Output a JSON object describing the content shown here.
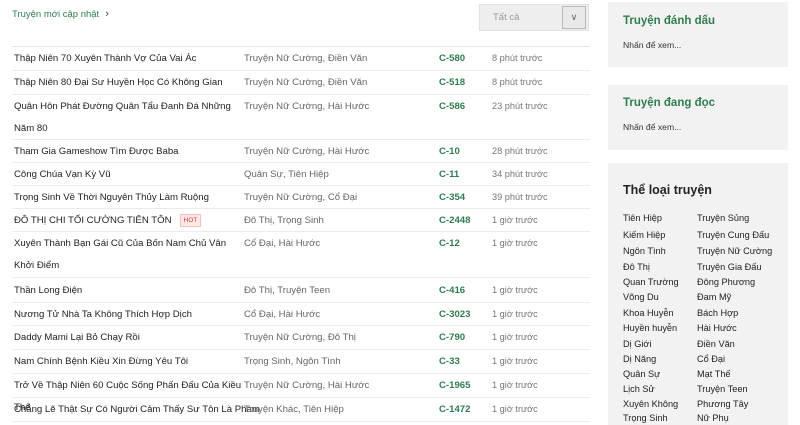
{
  "header": {
    "section_link": "Truyện mới cập nhật",
    "filter_value": "Tất cả"
  },
  "stories": [
    {
      "title": "Thập Niên 70 Xuyên Thành Vợ Của Vai Ác",
      "categories": "Truyện Nữ Cường, Điền Văn",
      "chapter": "C-580",
      "time": "8 phút trước"
    },
    {
      "title": "Thập Niên 80 Đại Sư Huyền Học Có Không Gian",
      "categories": "Truyện Nữ Cường, Điền Văn",
      "chapter": "C-518",
      "time": "8 phút trước"
    },
    {
      "title": "Quân Hôn Phát Đường Quân Tẩu Đanh Đá Những Năm 80",
      "categories": "Truyện Nữ Cường, Hài Hước",
      "chapter": "C-586",
      "time": "23 phút trước"
    },
    {
      "title": "Tham Gia Gameshow Tìm Được Baba",
      "categories": "Truyện Nữ Cường, Hài Hước",
      "chapter": "C-10",
      "time": "28 phút trước"
    },
    {
      "title": "Công Chúa Vạn Kỳ Vũ",
      "categories": "Quân Sự, Tiên Hiệp",
      "chapter": "C-11",
      "time": "34 phút trước"
    },
    {
      "title": "Trọng Sinh Về Thời Nguyên Thủy Làm Ruộng",
      "categories": "Truyện Nữ Cường, Cổ Đại",
      "chapter": "C-354",
      "time": "39 phút trước"
    },
    {
      "title": "ĐÔ THỊ CHI TỐI CƯỜNG TIÊN TÔN",
      "hot": "HOT",
      "categories": "Đô Thị, Trọng Sinh",
      "chapter": "C-2448",
      "time": "1 giờ trước"
    },
    {
      "title": "Xuyên Thành Bạn Gái Cũ Của Bốn Nam Chủ Vân Khởi Điểm",
      "categories": "Cổ Đại, Hài Hước",
      "chapter": "C-12",
      "time": "1 giờ trước"
    },
    {
      "title": "Thần Long Điện",
      "categories": "Đô Thị, Truyện Teen",
      "chapter": "C-416",
      "time": "1 giờ trước"
    },
    {
      "title": "Nương Tử Nhà Ta Không Thích Hợp Dịch",
      "categories": "Cổ Đại, Hài Hước",
      "chapter": "C-3023",
      "time": "1 giờ trước"
    },
    {
      "title": "Daddy Mami Lại Bỏ Chạy Rồi",
      "categories": "Truyện Nữ Cường, Đô Thị",
      "chapter": "C-790",
      "time": "1 giờ trước"
    },
    {
      "title": "Nam Chính Bệnh Kiều Xin Đừng Yêu Tôi",
      "categories": "Trọng Sinh, Ngôn Tình",
      "chapter": "C-33",
      "time": "1 giờ trước"
    },
    {
      "title": "Trở Về Thập Niên 60 Cuộc Sống Phấn Đấu Của Kiều Thê",
      "categories": "Truyện Nữ Cường, Hài Hước",
      "chapter": "C-1965",
      "time": "1 giờ trước"
    },
    {
      "title": "Chẳng Lẽ Thật Sự Có Người Cảm Thấy Sư Tôn Là Phàm",
      "categories": "Truyện Khác, Tiên Hiệp",
      "chapter": "C-1472",
      "time": "1 giờ trước"
    }
  ],
  "sidebar": {
    "bookmark": {
      "title": "Truyện đánh dấu",
      "sub": "Nhấn để xem..."
    },
    "reading": {
      "title": "Truyện đang đọc",
      "sub": "Nhấn để xem..."
    },
    "genres_title": "Thể loại truyện",
    "genres_left": [
      "Tiên Hiệp",
      "Kiếm Hiệp",
      "Ngôn Tình",
      "Đô Thị",
      "Quan Trường",
      "Võng Du",
      "Khoa Huyễn",
      "Huyền huyễn",
      "Dị Giới",
      "Dị Năng",
      "Quân Sự",
      "Lịch Sử",
      "Xuyên Không",
      "Trọng Sinh"
    ],
    "genres_right": [
      "Truyện Sủng",
      "Truyện Cung Đấu",
      "Truyện Nữ Cường",
      "Truyện Gia Đấu",
      "Đông Phương",
      "Đam Mỹ",
      "Bách Hợp",
      "Hài Hước",
      "Điền Văn",
      "Cổ Đại",
      "Mạt Thế",
      "Truyện Teen",
      "Phương Tây",
      "Nữ Phụ"
    ]
  }
}
